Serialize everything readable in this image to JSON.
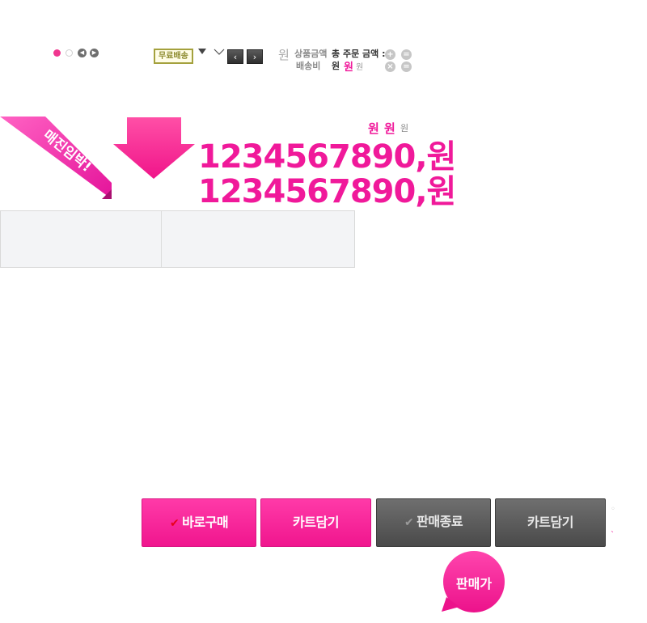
{
  "top_bar": {
    "free_shipping": "무료배송",
    "nav_prev": "‹",
    "nav_next": "›",
    "won_light": "원",
    "product_amount": "상품금액",
    "shipping_fee": "배송비",
    "total_order": "총 주문 금액 :",
    "won_1": "원",
    "won_2": "원",
    "won_3": "원",
    "op_plus": "+",
    "op_eq": "=",
    "op_times": "×",
    "op_eq2": "="
  },
  "ribbon": {
    "text": "매진임박!"
  },
  "price_header": {
    "won_a": "원",
    "won_b": "원",
    "won_c": "원"
  },
  "prices": {
    "line1": "1234567890,원",
    "line2": "1234567890,원"
  },
  "buttons": {
    "buy_now": "바로구매",
    "cart_1": "카트담기",
    "sold_out": "판매종료",
    "cart_2": "카트담기"
  },
  "bubble": {
    "label": "판매가"
  },
  "colors": {
    "accent_pink": "#f0199a",
    "dark_button": "#4f4f4f",
    "badge_olive": "#a4a13d"
  }
}
